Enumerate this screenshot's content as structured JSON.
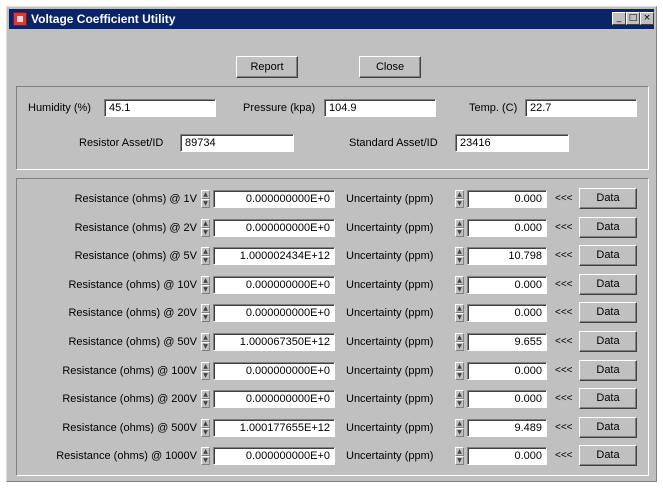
{
  "window": {
    "title": "Voltage Coefficient Utility"
  },
  "titlebar_buttons": {
    "minimize": "_",
    "maximize": "□",
    "close": "×"
  },
  "toolbar": {
    "report_label": "Report",
    "close_label": "Close"
  },
  "conditions": {
    "humidity_label": "Humidity (%)",
    "humidity_value": "45.1",
    "pressure_label": "Pressure (kpa)",
    "pressure_value": "104.9",
    "temp_label": "Temp. (C)",
    "temp_value": "22.7",
    "resistor_label": "Resistor Asset/ID",
    "resistor_value": "89734",
    "standard_label": "Standard Asset/ID",
    "standard_value": "23416"
  },
  "rows": [
    {
      "label": "Resistance (ohms) @ 1V",
      "resistance": "0.000000000E+0",
      "uncertainty_label": "Uncertainty (ppm)",
      "uncertainty": "0.000",
      "arrows": "<<<",
      "button": "Data"
    },
    {
      "label": "Resistance (ohms) @ 2V",
      "resistance": "0.000000000E+0",
      "uncertainty_label": "Uncertainty (ppm)",
      "uncertainty": "0.000",
      "arrows": "<<<",
      "button": "Data"
    },
    {
      "label": "Resistance (ohms) @ 5V",
      "resistance": "1.000002434E+12",
      "uncertainty_label": "Uncertainty (ppm)",
      "uncertainty": "10.798",
      "arrows": "<<<",
      "button": "Data"
    },
    {
      "label": "Resistance (ohms) @ 10V",
      "resistance": "0.000000000E+0",
      "uncertainty_label": "Uncertainty (ppm)",
      "uncertainty": "0.000",
      "arrows": "<<<",
      "button": "Data"
    },
    {
      "label": "Resistance (ohms) @ 20V",
      "resistance": "0.000000000E+0",
      "uncertainty_label": "Uncertainty (ppm)",
      "uncertainty": "0.000",
      "arrows": "<<<",
      "button": "Data"
    },
    {
      "label": "Resistance (ohms) @ 50V",
      "resistance": "1.000067350E+12",
      "uncertainty_label": "Uncertainty (ppm)",
      "uncertainty": "9.655",
      "arrows": "<<<",
      "button": "Data"
    },
    {
      "label": "Resistance (ohms) @ 100V",
      "resistance": "0.000000000E+0",
      "uncertainty_label": "Uncertainty (ppm)",
      "uncertainty": "0.000",
      "arrows": "<<<",
      "button": "Data"
    },
    {
      "label": "Resistance (ohms) @ 200V",
      "resistance": "0.000000000E+0",
      "uncertainty_label": "Uncertainty (ppm)",
      "uncertainty": "0.000",
      "arrows": "<<<",
      "button": "Data"
    },
    {
      "label": "Resistance (ohms) @ 500V",
      "resistance": "1.000177655E+12",
      "uncertainty_label": "Uncertainty (ppm)",
      "uncertainty": "9.489",
      "arrows": "<<<",
      "button": "Data"
    },
    {
      "label": "Resistance (ohms) @ 1000V",
      "resistance": "0.000000000E+0",
      "uncertainty_label": "Uncertainty (ppm)",
      "uncertainty": "0.000",
      "arrows": "<<<",
      "button": "Data"
    }
  ]
}
